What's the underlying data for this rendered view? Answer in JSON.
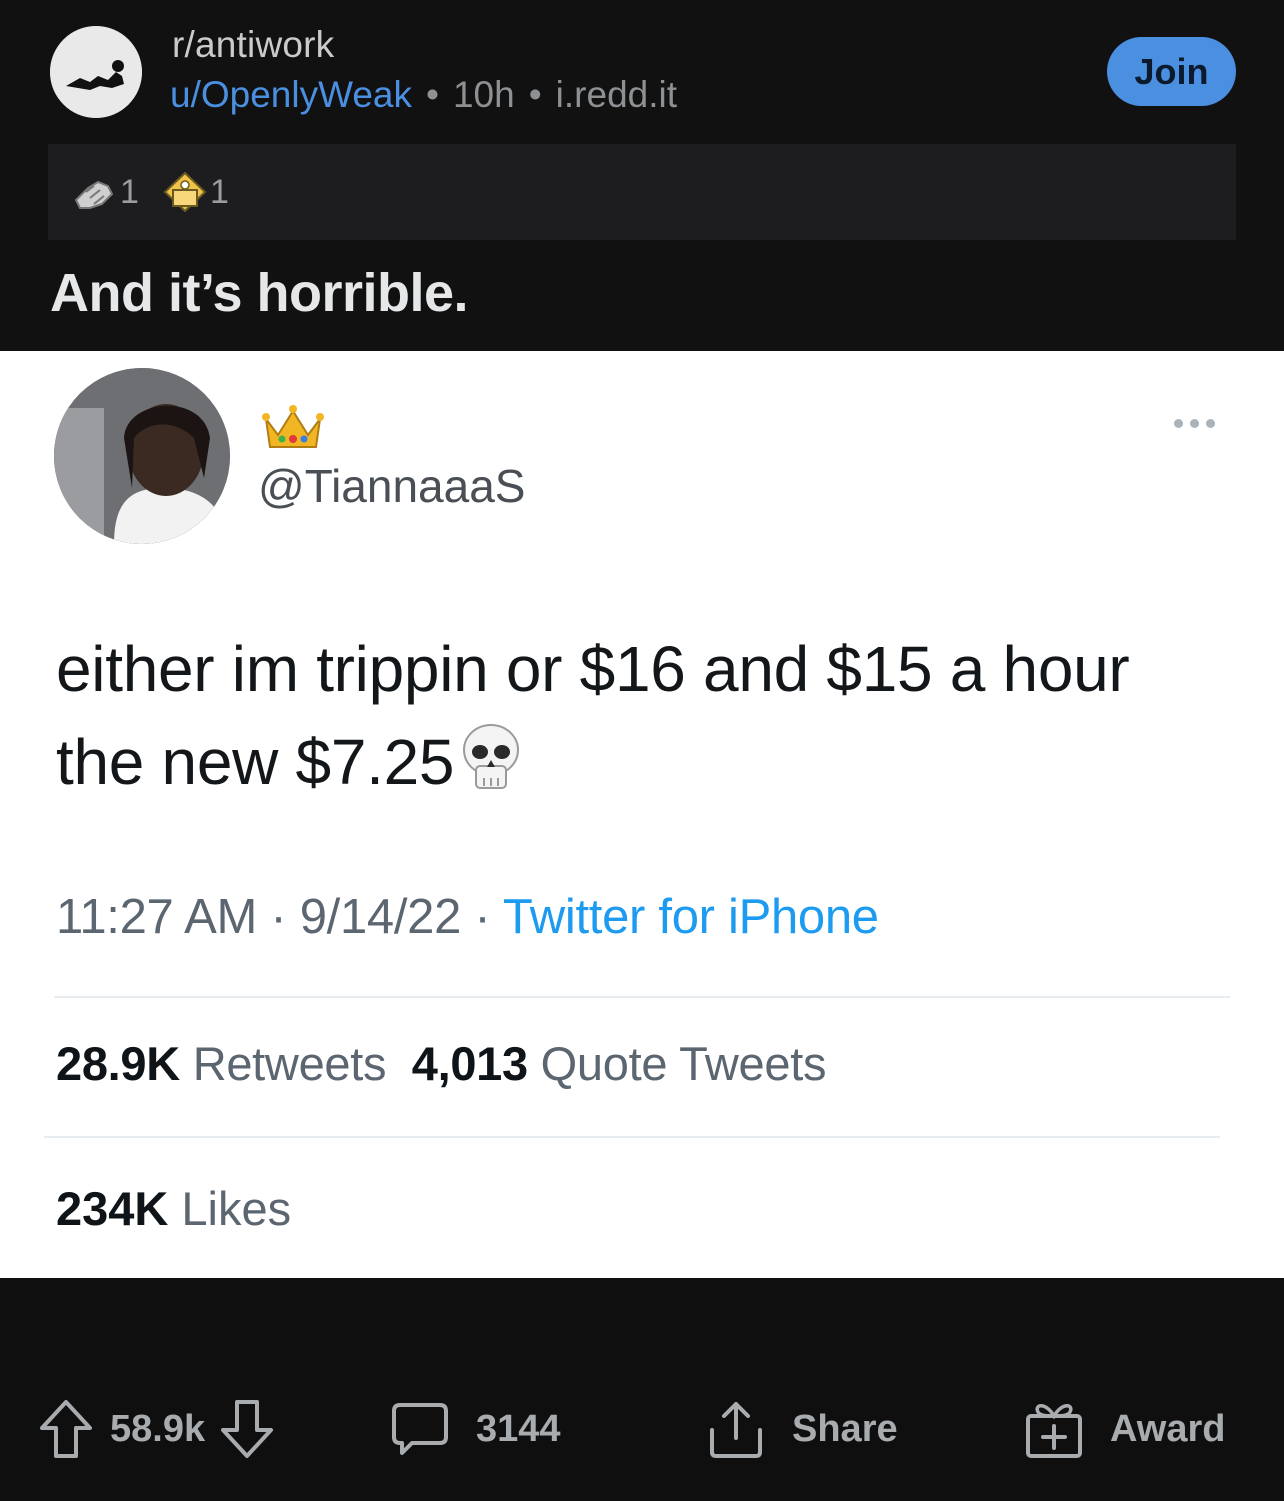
{
  "post": {
    "subreddit": "r/antiwork",
    "author": "u/OpenlyWeak",
    "age": "10h",
    "domain": "i.redd.it",
    "separator": "•",
    "join_label": "Join",
    "awards": [
      {
        "icon": "wholesome-seal-icon",
        "count": "1"
      },
      {
        "icon": "helpful-award-icon",
        "count": "1"
      }
    ],
    "title": "And it’s horrible."
  },
  "tweet": {
    "name_emoji": "crown-emoji",
    "handle": "@TiannaaaS",
    "text": "either im trippin or $16 and $15 a hour the new $7.25",
    "text_emoji": "skull-emoji",
    "time": "11:27 AM",
    "date": "9/14/22",
    "client": "Twitter for iPhone",
    "meta_sep": "·",
    "retweets_count": "28.9K",
    "retweets_label": "Retweets",
    "quote_count": "4,013",
    "quote_label": "Quote Tweets",
    "likes_count": "234K",
    "likes_label": "Likes"
  },
  "actions": {
    "votes": "58.9k",
    "comments": "3144",
    "share_label": "Share",
    "award_label": "Award"
  },
  "colors": {
    "background": "#0f0f10",
    "accent_blue": "#4a8fe0",
    "twitter_blue": "#1d9bf0",
    "tweet_bg": "#ffffff"
  }
}
